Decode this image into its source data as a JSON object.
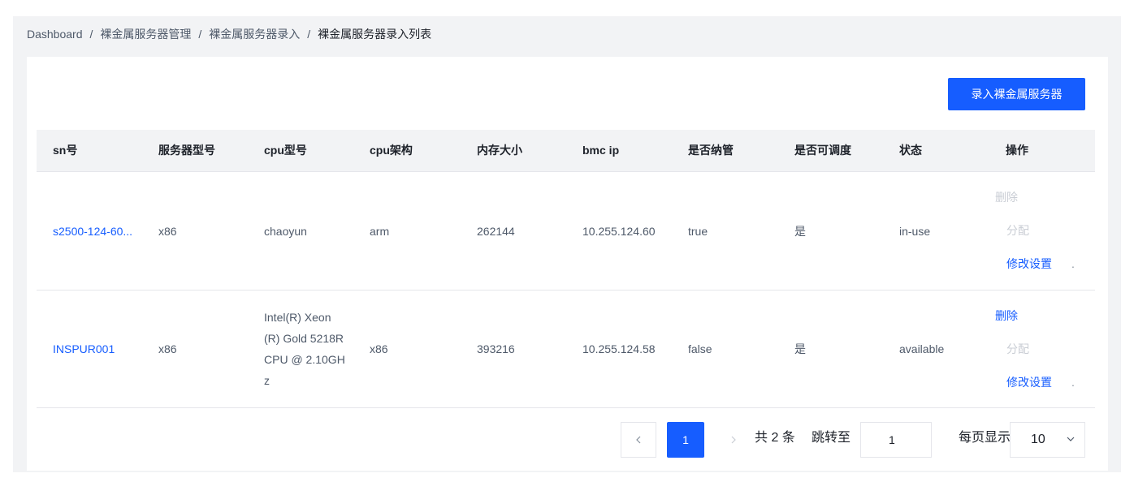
{
  "breadcrumb": {
    "items": [
      "Dashboard",
      "裸金属服务器管理",
      "裸金属服务器录入",
      "裸金属服务器录入列表"
    ],
    "separator": "/"
  },
  "toolbar": {
    "add_label": "录入裸金属服务器"
  },
  "table": {
    "columns": [
      "sn号",
      "服务器型号",
      "cpu型号",
      "cpu架构",
      "内存大小",
      "bmc ip",
      "是否纳管",
      "是否可调度",
      "状态",
      "操作"
    ],
    "rows": [
      {
        "sn": "s2500-124-60...",
        "model": "x86",
        "cpu_model": "chaoyun",
        "cpu_arch": "arm",
        "memory": "262144",
        "bmc_ip": "10.255.124.60",
        "managed": "true",
        "schedulable": "是",
        "status": "in-use",
        "actions": {
          "delete": "删除",
          "assign": "分配",
          "modify": "修改设置",
          "more": "."
        }
      },
      {
        "sn": "INSPUR001",
        "model": "x86",
        "cpu_model": "Intel(R) Xeon(R) Gold 5218R CPU @ 2.10GHz",
        "cpu_arch": "x86",
        "memory": "393216",
        "bmc_ip": "10.255.124.58",
        "managed": "false",
        "schedulable": "是",
        "status": "available",
        "actions": {
          "delete": "删除",
          "assign": "分配",
          "modify": "修改设置",
          "more": "."
        }
      }
    ]
  },
  "pagination": {
    "prev_icon": "chevron-left-icon",
    "next_icon": "chevron-right-icon",
    "current_page": "1",
    "total_label": "共 2 条",
    "jump_label": "跳转至",
    "jump_value": "1",
    "page_size_label": "每页显示",
    "page_size": "10"
  },
  "colors": {
    "primary": "#165dff",
    "disabled": "#c9cdd4",
    "header_bg": "#f2f3f5"
  }
}
